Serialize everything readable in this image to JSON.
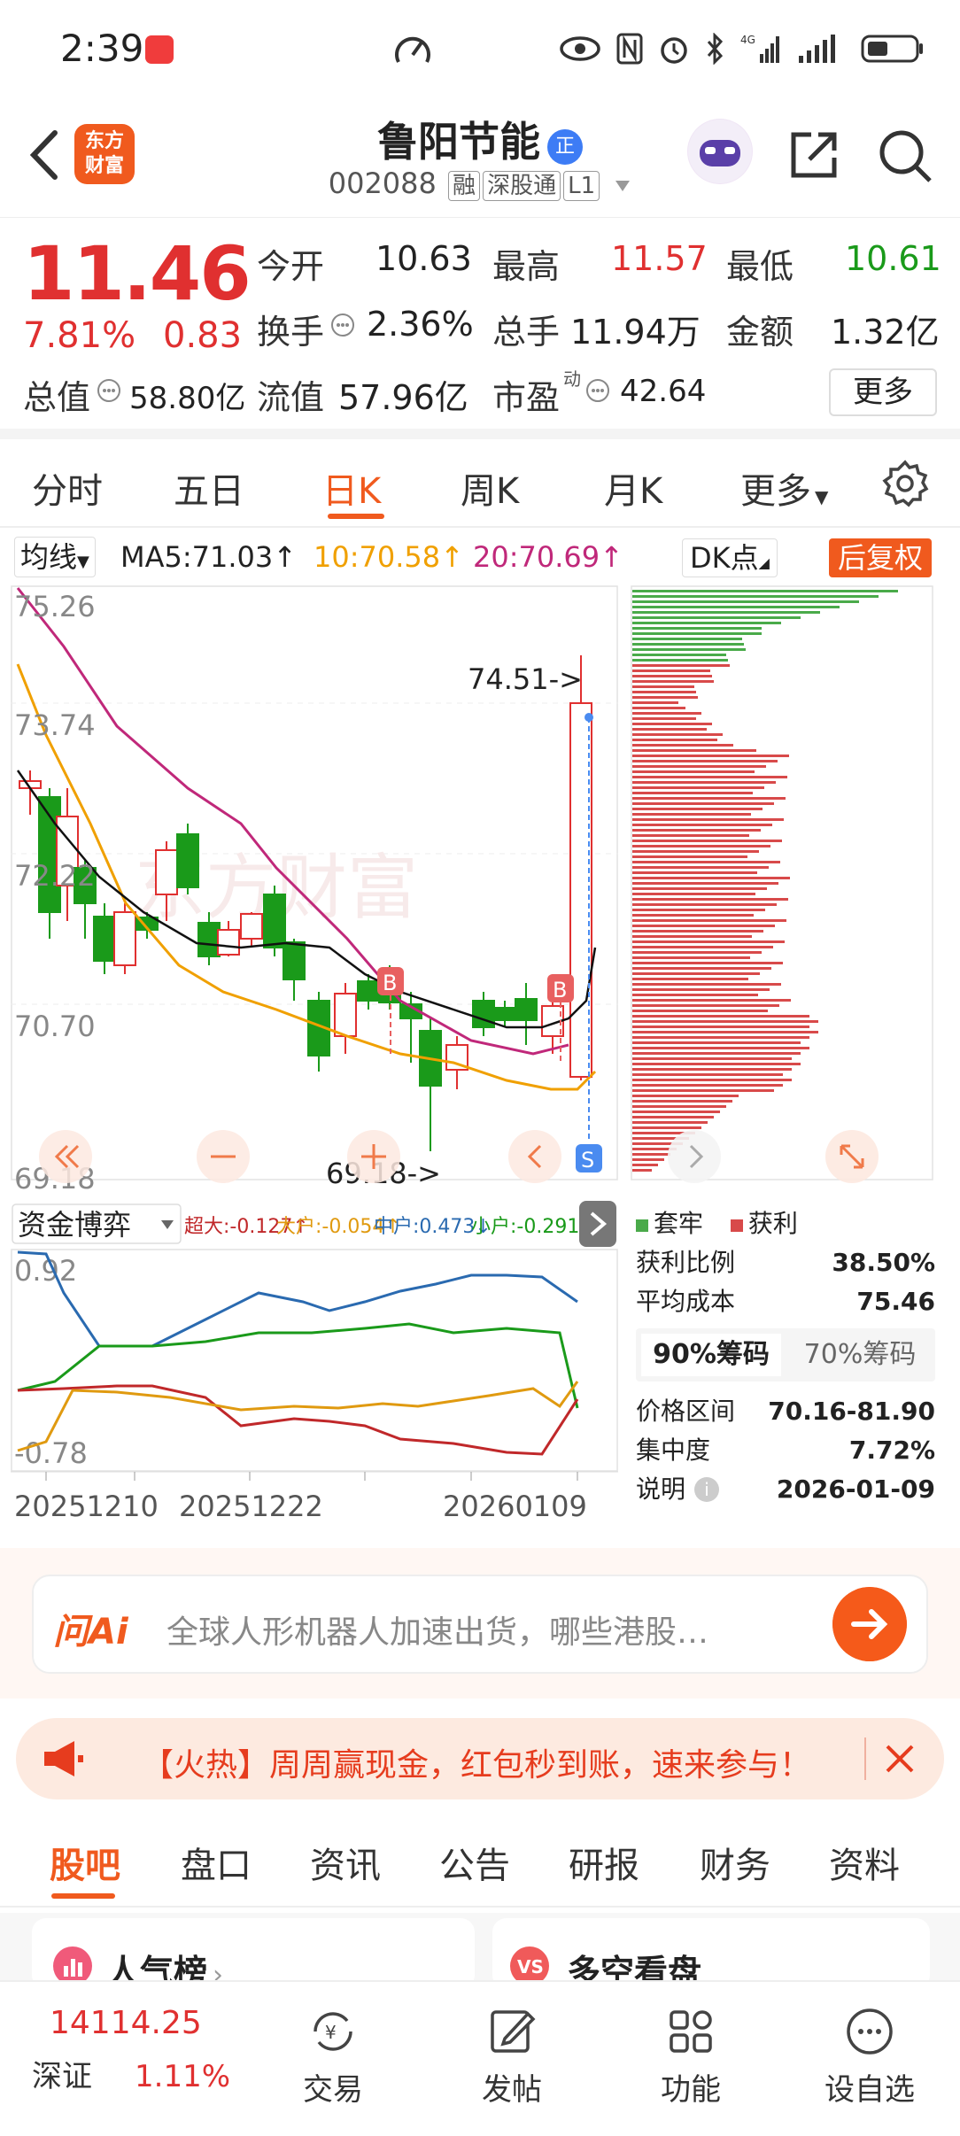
{
  "status_bar": {
    "time": "2:39",
    "network": "4G"
  },
  "header": {
    "logo_text_1": "东方",
    "logo_text_2": "财富",
    "stock_name": "鲁阳节能",
    "name_badge": "正",
    "stock_code": "002088",
    "tags": [
      "融",
      "深股通",
      "L1"
    ]
  },
  "quote": {
    "price": "11.46",
    "change_pct": "7.81%",
    "change_val": "0.83",
    "fields": [
      {
        "label": "今开",
        "value": "10.63",
        "color": "#222222"
      },
      {
        "label": "最高",
        "value": "11.57",
        "color": "#e03030"
      },
      {
        "label": "最低",
        "value": "10.61",
        "color": "#1a9a1a"
      },
      {
        "label": "换手",
        "value": "2.36%",
        "color": "#222222"
      },
      {
        "label": "总手",
        "value": "11.94万",
        "color": "#222222"
      },
      {
        "label": "金额",
        "value": "1.32亿",
        "color": "#222222"
      },
      {
        "label": "总值",
        "value": "58.80亿",
        "color": "#222222"
      },
      {
        "label": "流值",
        "value": "57.96亿",
        "color": "#222222"
      },
      {
        "label": "市盈",
        "value": "42.64",
        "color": "#222222"
      }
    ],
    "pe_sup": "动",
    "more_label": "更多"
  },
  "period_tabs": [
    "分时",
    "五日",
    "日K",
    "周K",
    "月K",
    "更多"
  ],
  "active_period": "日K",
  "ma_bar": {
    "select_label": "均线",
    "ma5": "MA5:71.03↑",
    "ma10": "10:70.58↑",
    "ma20": "20:70.69↑",
    "dk_label": "DK点",
    "fq_label": "后复权"
  },
  "kline": {
    "y_labels": [
      "75.26",
      "73.74",
      "72.22",
      "70.70",
      "69.18"
    ],
    "high_label": "74.51->",
    "low_label": "69.18->",
    "watermark": "东方财富",
    "b_marker": "B",
    "s_marker": "S"
  },
  "fund_chart": {
    "title": "资金博弈",
    "super": "超大:-0.127↑",
    "big": "大户:-0.054↑",
    "mid": "中户:0.473↓",
    "small": "小户:-0.291↓",
    "y_top": "0.92",
    "y_bottom": "-0.78",
    "dates": [
      "20251210",
      "20251222",
      "20260109"
    ]
  },
  "chip_info": {
    "legend_trapped": "套牢",
    "legend_profit": "获利",
    "rows_top": [
      {
        "label": "获利比例",
        "value": "38.50%"
      },
      {
        "label": "平均成本",
        "value": "75.46"
      }
    ],
    "tab_90": "90%筹码",
    "tab_70": "70%筹码",
    "rows_bottom": [
      {
        "label": "价格区间",
        "value": "70.16-81.90"
      },
      {
        "label": "集中度",
        "value": "7.72%"
      },
      {
        "label": "说明",
        "value": "2026-01-09"
      }
    ]
  },
  "ai_search": {
    "logo": "问Ai",
    "placeholder": "全球人形机器人加速出货，哪些港股…"
  },
  "promo": {
    "text": "【火热】周周赢现金，红包秒到账，速来参与！"
  },
  "bottom_tabs": [
    "股吧",
    "盘口",
    "资讯",
    "公告",
    "研报",
    "财务",
    "资料"
  ],
  "cards": {
    "left": "人气榜",
    "right": "多空看盘"
  },
  "navbar": {
    "index_value": "14114.25",
    "index_name": "深证",
    "index_change": "1.11%",
    "items": [
      "交易",
      "发帖",
      "功能",
      "设自选"
    ]
  },
  "colors": {
    "accent": "#f05a1e",
    "up": "#e03030",
    "down": "#1a9a1a"
  }
}
